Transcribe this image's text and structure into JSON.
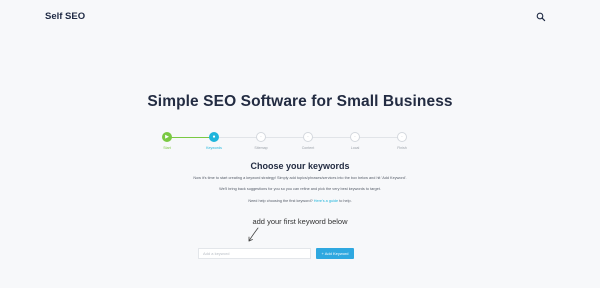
{
  "header": {
    "logo": "Self SEO",
    "search_icon": "search-icon"
  },
  "hero": {
    "title": "Simple SEO Software for Small Business"
  },
  "steps": [
    {
      "label": "Start",
      "state": "done",
      "icon": "play-icon"
    },
    {
      "label": "Keywords",
      "state": "active",
      "icon": "search-icon"
    },
    {
      "label": "Sitemap",
      "state": "pending",
      "icon": "sitemap-icon"
    },
    {
      "label": "Content",
      "state": "pending",
      "icon": "content-icon"
    },
    {
      "label": "Local",
      "state": "pending",
      "icon": "pin-icon"
    },
    {
      "label": "Finish",
      "state": "pending",
      "icon": "flag-icon"
    }
  ],
  "colors": {
    "done": "#7ac943",
    "active": "#1fb5dc",
    "button": "#2fa8e0"
  },
  "main": {
    "heading": "Choose your keywords",
    "intro": "Now it's time to start creating a keyword strategy! Simply add topics/phrases/services into the box below and hit 'Add Keyword'.",
    "suggestions": "We'll bring back suggestions for you so you can refine and pick the very best keywords to target.",
    "help_prefix": "Need help choosing the first keyword? ",
    "help_link": "Here's a guide",
    "help_suffix": " to help.",
    "handwritten": "add your first keyword below"
  },
  "form": {
    "input_placeholder": "Add a keyword",
    "button_label": "+ Add Keyword"
  }
}
